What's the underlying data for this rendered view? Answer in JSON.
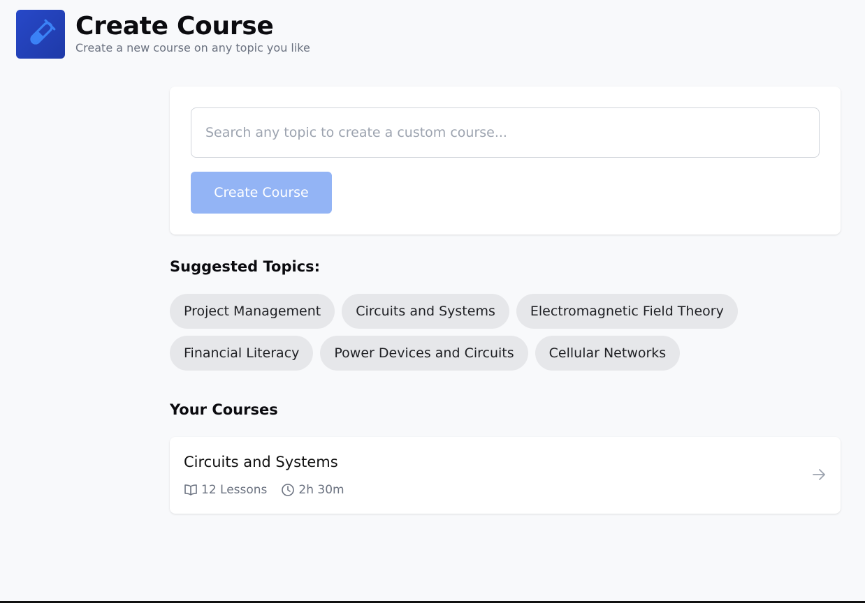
{
  "header": {
    "title": "Create Course",
    "subtitle": "Create a new course on any topic you like",
    "logo_icon": "test-tube-icon",
    "brand_color": "#2748c8"
  },
  "create_form": {
    "search_placeholder": "Search any topic to create a custom course...",
    "search_value": "",
    "create_button_label": "Create Course",
    "button_color": "#93b4f5"
  },
  "suggested": {
    "title": "Suggested Topics:",
    "topics": [
      "Project Management",
      "Circuits and Systems",
      "Electromagnetic Field Theory",
      "Financial Literacy",
      "Power Devices and Circuits",
      "Cellular Networks"
    ]
  },
  "courses": {
    "title": "Your Courses",
    "items": [
      {
        "title": "Circuits and Systems",
        "lessons": "12 Lessons",
        "duration": "2h 30m",
        "lessons_icon": "book-open-icon",
        "duration_icon": "clock-icon",
        "open_icon": "arrow-right-icon"
      }
    ]
  }
}
